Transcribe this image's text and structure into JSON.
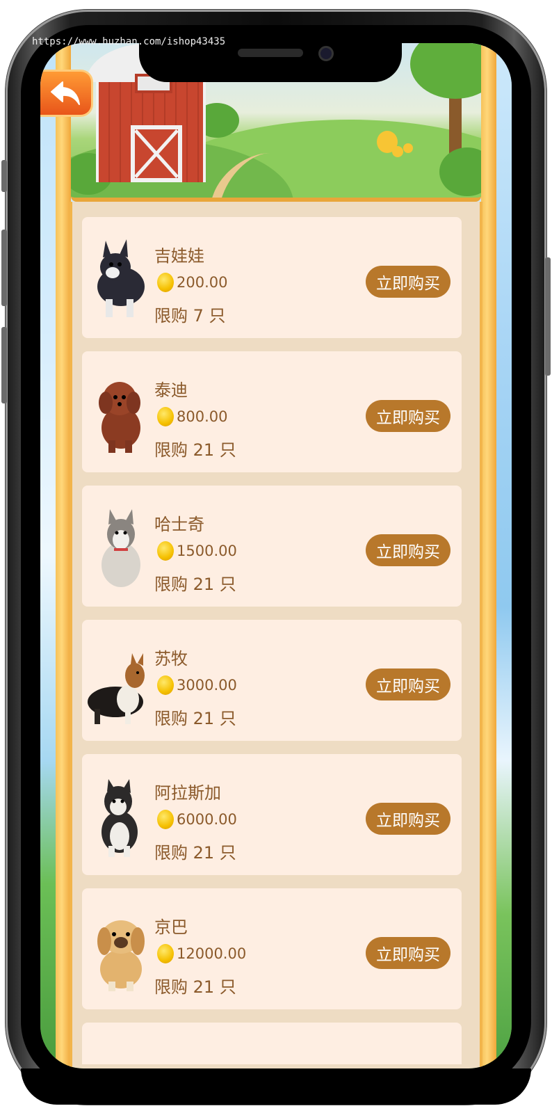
{
  "watermark": "https://www.huzhan.com/ishop43435",
  "products": [
    {
      "name": "吉娃娃",
      "price": "200.00",
      "limit": "限购 7 只",
      "button": "立即购买",
      "icon": "chihuahua-icon"
    },
    {
      "name": "泰迪",
      "price": "800.00",
      "limit": "限购 21 只",
      "button": "立即购买",
      "icon": "teddy-icon"
    },
    {
      "name": "哈士奇",
      "price": "1500.00",
      "limit": "限购 21 只",
      "button": "立即购买",
      "icon": "husky-icon"
    },
    {
      "name": "苏牧",
      "price": "3000.00",
      "limit": "限购 21 只",
      "button": "立即购买",
      "icon": "collie-icon"
    },
    {
      "name": "阿拉斯加",
      "price": "6000.00",
      "limit": "限购 21 只",
      "button": "立即购买",
      "icon": "malamute-icon"
    },
    {
      "name": "京巴",
      "price": "12000.00",
      "limit": "限购 21 只",
      "button": "立即购买",
      "icon": "pekingese-icon"
    }
  ],
  "colors": {
    "accent": "#b8782b",
    "text": "#8b5a2b",
    "card": "#feeee2",
    "panel": "#eedcc3",
    "rail": "#f6c25a"
  }
}
